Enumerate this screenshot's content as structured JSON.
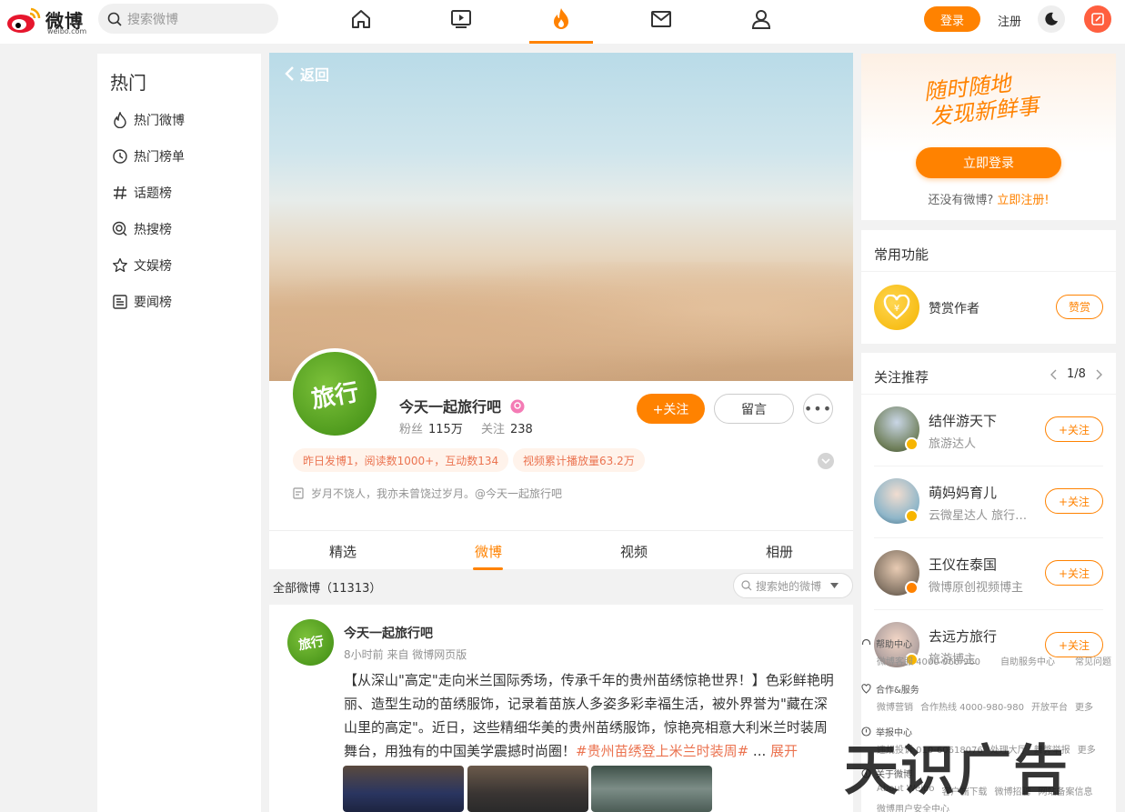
{
  "topnav": {
    "logo_text": "微博",
    "logo_sub": "weibo.com",
    "search_placeholder": "搜索微博",
    "login_label": "登录",
    "register_label": "注册"
  },
  "sidebar": {
    "title": "热门",
    "items": [
      {
        "label": "热门微博",
        "icon": "flame-icon"
      },
      {
        "label": "热门榜单",
        "icon": "clock-icon"
      },
      {
        "label": "话题榜",
        "icon": "hashtag-icon"
      },
      {
        "label": "热搜榜",
        "icon": "search-circle-icon"
      },
      {
        "label": "文娱榜",
        "icon": "star-icon"
      },
      {
        "label": "要闻榜",
        "icon": "news-icon"
      }
    ]
  },
  "profile": {
    "back_label": "返回",
    "avatar_text": "旅行",
    "name": "今天一起旅行吧",
    "fans_label": "粉丝",
    "fans_value": "115万",
    "follow_label": "关注",
    "follow_value": "238",
    "follow_button": "+关注",
    "message_button": "留言",
    "more_button": "•••",
    "tags": [
      "昨日发博1，阅读数1000+，互动数134",
      "视频累计播放量63.2万"
    ],
    "bio": "岁月不饶人，我亦未曾饶过岁月。@今天一起旅行吧"
  },
  "tabs": [
    "精选",
    "微博",
    "视频",
    "相册"
  ],
  "feed": {
    "all_label": "全部微博（11313）",
    "search_placeholder": "搜索她的微博"
  },
  "post": {
    "avatar_text": "旅行",
    "author": "今天一起旅行吧",
    "meta": "8小时前  来自 微博网页版",
    "text": "【从深山\"高定\"走向米兰国际秀场，传承千年的贵州苗绣惊艳世界！】色彩鲜艳明丽、造型生动的苗绣服饰，记录着苗族人多姿多彩幸福生活，被外界誉为\"藏在深山里的高定\"。近日，这些精细华美的贵州苗绣服饰，惊艳亮相意大利米兰时装周舞台，用独有的中国美学震撼时尚圈！",
    "topic": "#贵州苗绣登上米兰时装周#",
    "ellipsis": " ... ",
    "expand": "展开"
  },
  "login_card": {
    "slogan_line1": "随时随地",
    "slogan_line2": "发现新鲜事",
    "button": "立即登录",
    "no_account": "还没有微博?",
    "register_now": "立即注册!"
  },
  "functions": {
    "title": "常用功能",
    "reward_label": "赞赏作者",
    "reward_button": "赞赏"
  },
  "recommend": {
    "title": "关注推荐",
    "page": "1/8",
    "items": [
      {
        "name": "结伴游天下",
        "desc": "旅游达人",
        "follow": "+关注"
      },
      {
        "name": "萌妈妈育儿",
        "desc": "云微星达人 旅行博主",
        "follow": "+关注"
      },
      {
        "name": "王仪在泰国",
        "desc": "微博原创视频博主",
        "follow": "+关注"
      },
      {
        "name": "去远方旅行",
        "desc": "旅游博主",
        "follow": "+关注"
      }
    ]
  },
  "footer": {
    "help_title": "帮助中心",
    "help_links": [
      "微博客服 4000-960-960",
      "自助服务中心",
      "常见问题"
    ],
    "coop_title": "合作&服务",
    "coop_links": [
      "微博营销",
      "合作热线 4000-980-980",
      "开放平台",
      "更多"
    ],
    "report_title": "举报中心",
    "report_links": [
      "违规投诉 010-60618076",
      "处理大厅",
      "舞弊举报",
      "更多"
    ],
    "about_title": "关于微博",
    "about_links": [
      "About Weibo",
      "客户端下载",
      "微博招聘",
      "网站备案信息"
    ],
    "about_links2": [
      "微博用户安全中心"
    ]
  },
  "watermark": "天识广告",
  "colors": {
    "accent": "#ff8200",
    "tag_text": "#eb7350",
    "tag_bg": "#fff3eb"
  }
}
